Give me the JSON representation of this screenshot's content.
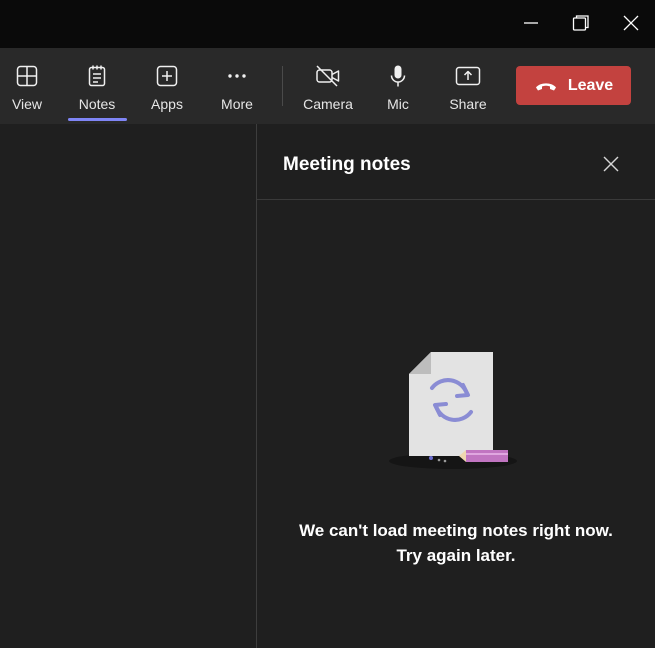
{
  "window_controls": {
    "minimize_icon": "minimize-icon",
    "restore_icon": "restore-icon",
    "close_icon": "close-icon"
  },
  "toolbar": {
    "items": [
      {
        "label": "View",
        "icon": "grid-view-icon"
      },
      {
        "label": "Notes",
        "icon": "notes-icon",
        "active": true
      },
      {
        "label": "Apps",
        "icon": "add-app-icon"
      },
      {
        "label": "More",
        "icon": "more-icon"
      },
      {
        "label": "Camera",
        "icon": "camera-off-icon"
      },
      {
        "label": "Mic",
        "icon": "mic-icon"
      },
      {
        "label": "Share",
        "icon": "share-icon"
      }
    ],
    "leave_label": "Leave",
    "leave_icon": "phone-hangup-icon",
    "accent_color": "#7f85f5",
    "leave_color": "#c3423f"
  },
  "notes_panel": {
    "title": "Meeting notes",
    "close_icon": "close-icon",
    "error_line1": "We can't load meeting notes right now.",
    "error_line2": "Try again later.",
    "illustration_icon": "document-refresh-icon"
  }
}
